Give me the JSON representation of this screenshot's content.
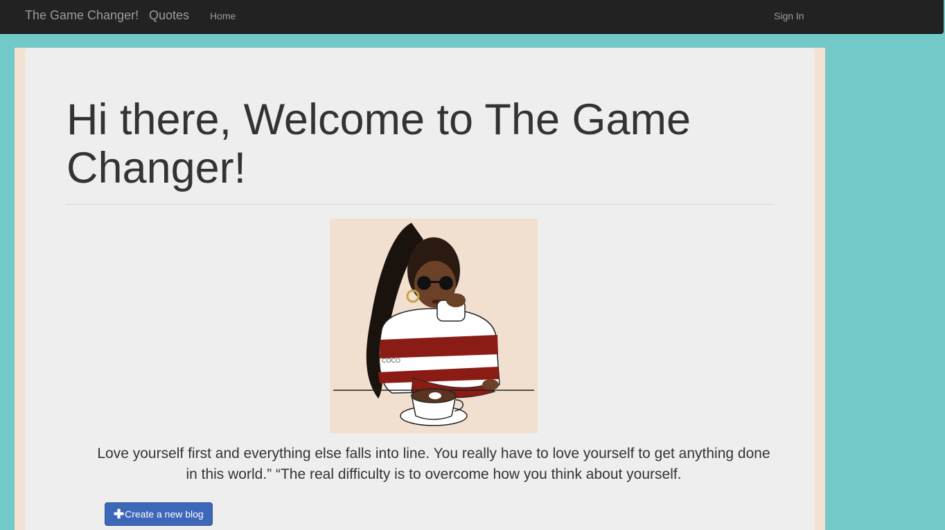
{
  "navbar": {
    "brand": "The Game Changer!",
    "quotes_link": "Quotes",
    "home_link": "Home",
    "signin_link": "Sign In"
  },
  "main": {
    "title": "Hi there, Welcome to The Game Changer!",
    "quote": "Love yourself first and everything else falls into line. You really have to love yourself to get anything done in this world.” “The real difficulty is to overcome how you think about yourself.",
    "illustration_text": "COCO",
    "create_button_label": "Create a new blog",
    "create_button_icon": "plus-icon"
  },
  "colors": {
    "navbar_bg": "#222222",
    "page_bg": "#72c9c7",
    "panel_bg": "#eeeeee",
    "frame_bg": "#f3e2d2",
    "button_bg": "#3d67b8"
  }
}
